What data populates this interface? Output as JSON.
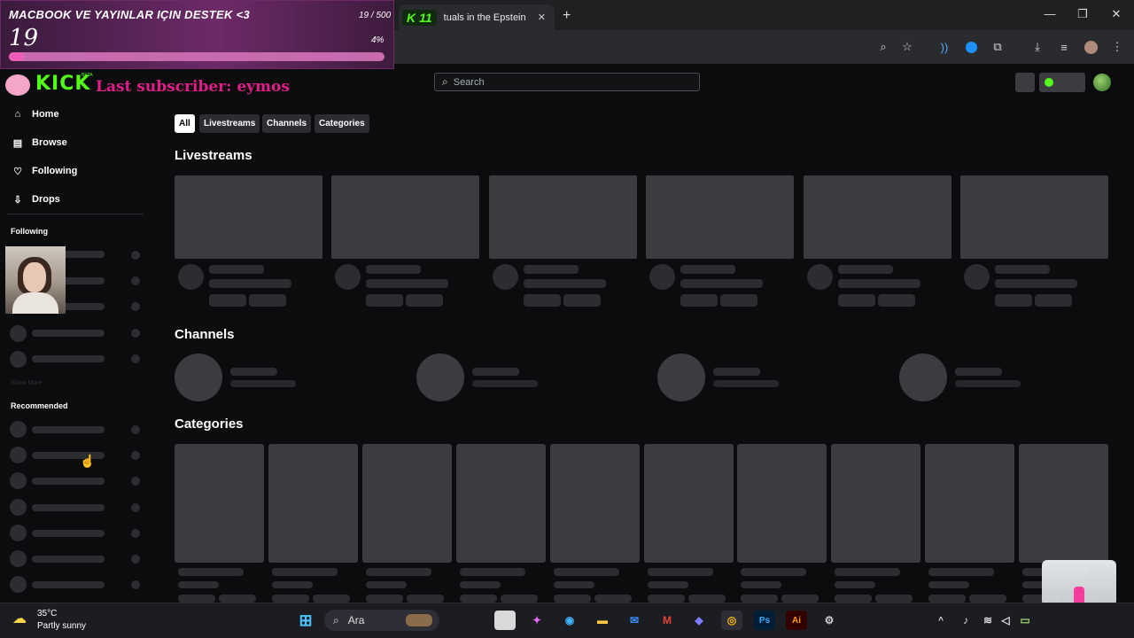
{
  "overlay": {
    "title": "MACBOOK VE YAYINLAR IÇIN DESTEK <3",
    "count": "19 / 500",
    "current": "19",
    "percent": "4%",
    "progress": 0.04
  },
  "browser": {
    "tab_badge": "11",
    "tab_title": "tuals in the Epstein",
    "new_tab": "+",
    "window_controls": [
      "—",
      "❐",
      "✕"
    ]
  },
  "kick": {
    "logo": "KICK",
    "beta": "BETA",
    "last_subscriber": "Last subscriber: eymos",
    "search_placeholder": "Search",
    "nav": [
      {
        "label": "Home",
        "icon": "home-icon"
      },
      {
        "label": "Browse",
        "icon": "compass-icon"
      },
      {
        "label": "Following",
        "icon": "heart-icon"
      },
      {
        "label": "Drops",
        "icon": "drops-icon"
      }
    ],
    "following_heading": "Following",
    "show_more": "Show More",
    "recommended_heading": "Recommended",
    "filters": [
      "All",
      "Livestreams",
      "Channels",
      "Categories"
    ],
    "sections": {
      "livestreams": "Livestreams",
      "channels": "Channels",
      "categories": "Categories"
    }
  },
  "taskbar": {
    "temperature": "35°C",
    "weather": "Partly sunny",
    "search_label": "Ara",
    "apps": [
      "windows",
      "search",
      "animal-widget",
      "files",
      "copilot",
      "edge",
      "explorer",
      "mail",
      "gmail",
      "devhome",
      "chrome",
      "photoshop",
      "illustrator",
      "extra"
    ]
  },
  "colors": {
    "kick_green": "#53fc18",
    "subscriber_pink": "#e01e8a",
    "goal_purple": "#6d2a68"
  }
}
